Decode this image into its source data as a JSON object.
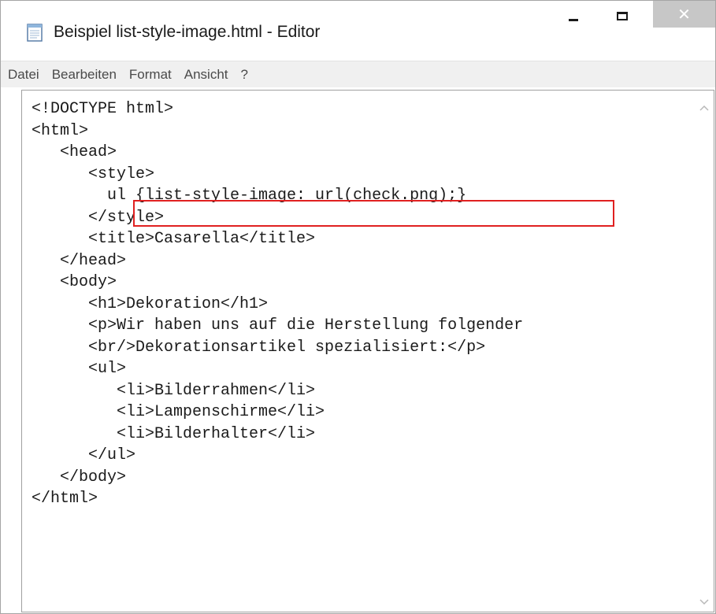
{
  "window": {
    "title": "Beispiel list-style-image.html - Editor",
    "buttons": {
      "minimize": "–",
      "maximize": "□",
      "close": "✕"
    }
  },
  "menu": [
    "Datei",
    "Bearbeiten",
    "Format",
    "Ansicht",
    "?"
  ],
  "editor": {
    "lines": [
      "<!DOCTYPE html>",
      "<html>",
      "   <head>",
      "      <style>",
      "        ul {list-style-image: url(check.png);}",
      "      </style>",
      "      <title>Casarella</title>",
      "   </head>",
      "   <body>",
      "      <h1>Dekoration</h1>",
      "      <p>Wir haben uns auf die Herstellung folgender",
      "      <br/>Dekorationsartikel spezialisiert:</p>",
      "      <ul>",
      "         <li>Bilderrahmen</li>",
      "         <li>Lampenschirme</li>",
      "         <li>Bilderhalter</li>",
      "      </ul>",
      "   </body>",
      "</html>"
    ],
    "highlight_color": "#e02020"
  },
  "icons": {
    "app": "notepad-icon",
    "scroll_up": "chevron-up-icon",
    "scroll_down": "chevron-down-icon"
  }
}
